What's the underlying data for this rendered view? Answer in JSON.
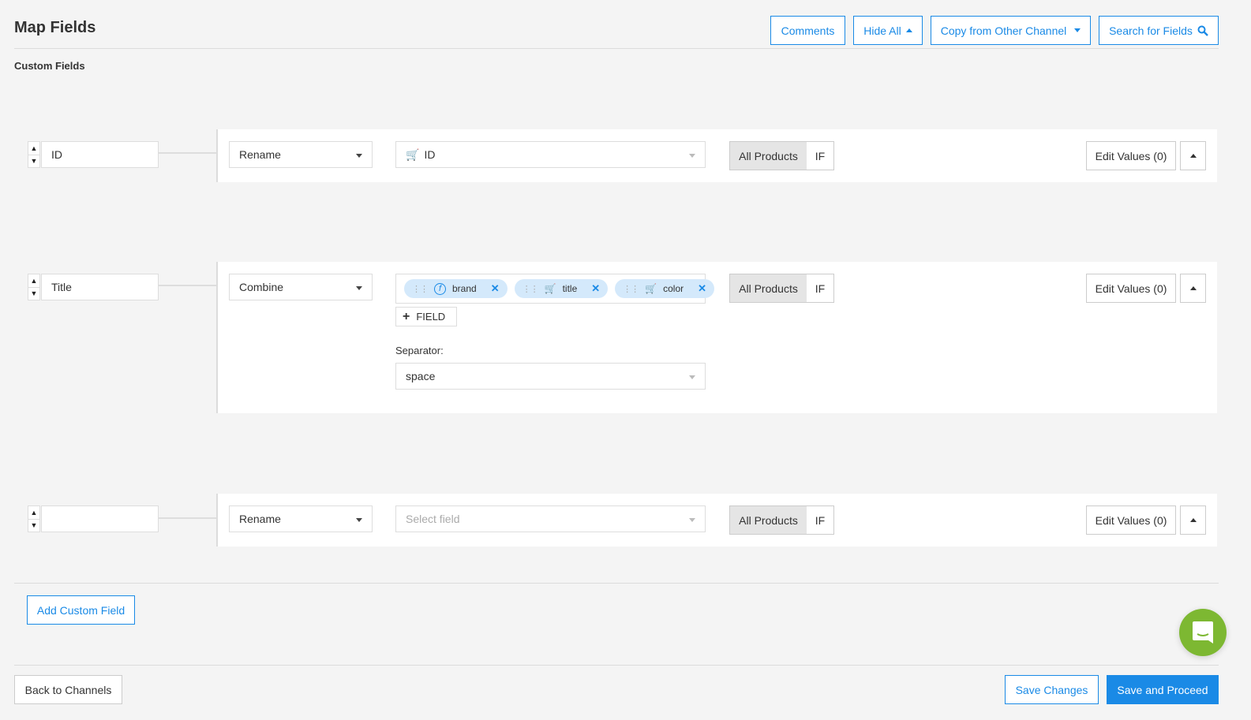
{
  "header": {
    "title": "Map Fields",
    "buttons": {
      "comments": "Comments",
      "hide_all": "Hide All",
      "copy": "Copy from Other Channel",
      "search": "Search for Fields"
    }
  },
  "section": "Custom Fields",
  "rows": [
    {
      "name": "ID",
      "action": "Rename",
      "field": "ID",
      "all_products": "All Products",
      "if": "IF",
      "edit": "Edit Values (0)"
    },
    {
      "name": "Title",
      "action": "Combine",
      "chips": [
        "brand",
        "title",
        "color"
      ],
      "add_field": "FIELD",
      "separator_label": "Separator:",
      "separator": "space",
      "all_products": "All Products",
      "if": "IF",
      "edit": "Edit Values (0)"
    },
    {
      "name": "",
      "action": "Rename",
      "field_placeholder": "Select field",
      "all_products": "All Products",
      "if": "IF",
      "edit": "Edit Values (0)"
    }
  ],
  "add_custom": "Add Custom Field",
  "footer": {
    "back": "Back to Channels",
    "save": "Save Changes",
    "proceed": "Save and Proceed"
  },
  "colors": {
    "accent": "#1a8ae6",
    "chat": "#7db832"
  }
}
